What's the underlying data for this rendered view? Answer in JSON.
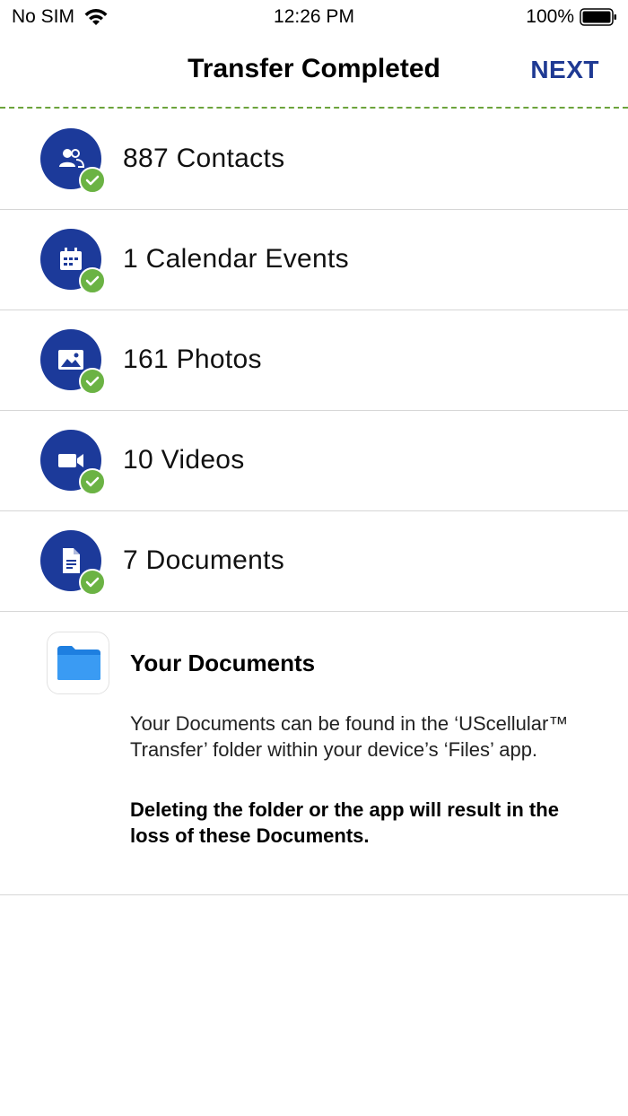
{
  "status_bar": {
    "carrier": "No SIM",
    "time": "12:26 PM",
    "battery": "100%"
  },
  "nav": {
    "title": "Transfer Completed",
    "next_label": "NEXT"
  },
  "colors": {
    "accent": "#1f3a93",
    "icon_bg": "#1c3a9a",
    "check": "#6bb344",
    "divider_green": "#6ca33c"
  },
  "items": [
    {
      "label": "887 Contacts",
      "icon": "contacts-icon"
    },
    {
      "label": "1 Calendar Events",
      "icon": "calendar-icon"
    },
    {
      "label": "161 Photos",
      "icon": "photo-icon"
    },
    {
      "label": "10 Videos",
      "icon": "video-icon"
    },
    {
      "label": "7 Documents",
      "icon": "document-icon"
    }
  ],
  "documents_section": {
    "title": "Your Documents",
    "body": "Your Documents can be found in the ‘UScellular™ Transfer’ folder within your device’s ‘Files’ app.",
    "warning": "Deleting the folder or the app will result in the loss of these Documents."
  }
}
